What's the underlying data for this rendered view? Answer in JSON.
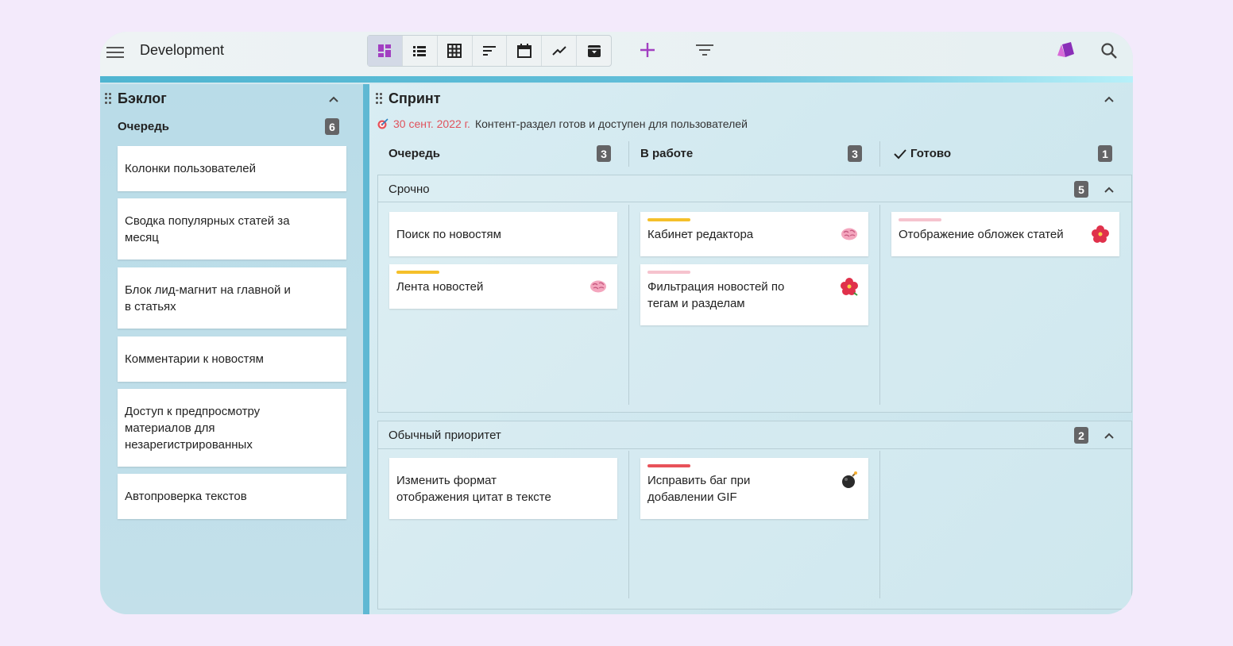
{
  "app": {
    "title": "Development"
  },
  "toolbar": {
    "views": [
      {
        "name": "board-view-icon",
        "active": true
      },
      {
        "name": "list-view-icon",
        "active": false
      },
      {
        "name": "table-view-icon",
        "active": false
      },
      {
        "name": "sort-view-icon",
        "active": false
      },
      {
        "name": "calendar-view-icon",
        "active": false
      },
      {
        "name": "chart-view-icon",
        "active": false
      },
      {
        "name": "archive-view-icon",
        "active": false
      }
    ],
    "accent": "#a23fc1"
  },
  "backlog": {
    "title": "Бэклог",
    "queue_label": "Очередь",
    "queue_count": "6",
    "cards": [
      "Колонки пользователей",
      "Сводка популярных статей за\nмесяц",
      "Блок лид-магнит на главной и\nв статьях",
      "Комментарии к новостям",
      "Доступ к предпросмотру\nматериалов для\nнезарегистрированных",
      "Автопроверка текстов"
    ]
  },
  "sprint": {
    "title": "Спринт",
    "milestone_date": "30 сент. 2022 г.",
    "milestone_text": "Контент-раздел готов и доступен для пользователей",
    "columns": [
      {
        "label": "Очередь",
        "count": "3"
      },
      {
        "label": "В работе",
        "count": "3"
      },
      {
        "label": "Готово",
        "count": "1"
      }
    ],
    "groups": [
      {
        "label": "Срочно",
        "count": "5"
      },
      {
        "label": "Обычный приоритет",
        "count": "2"
      }
    ],
    "cards": {
      "urgent_queue_1": "Поиск по новостям",
      "urgent_queue_2": "Лента новостей",
      "urgent_work_1": "Кабинет редактора",
      "urgent_work_2": "Фильтрация новостей по\nтегам и разделам",
      "urgent_done_1": "Отображение обложек статей",
      "normal_queue_1": "Изменить формат\nотображения цитат в тексте",
      "normal_work_1": "Исправить баг при\nдобавлении GIF"
    },
    "colors": {
      "yellow": "#f5c02a",
      "pink": "#f6c3ce",
      "red": "#e8525a"
    }
  }
}
